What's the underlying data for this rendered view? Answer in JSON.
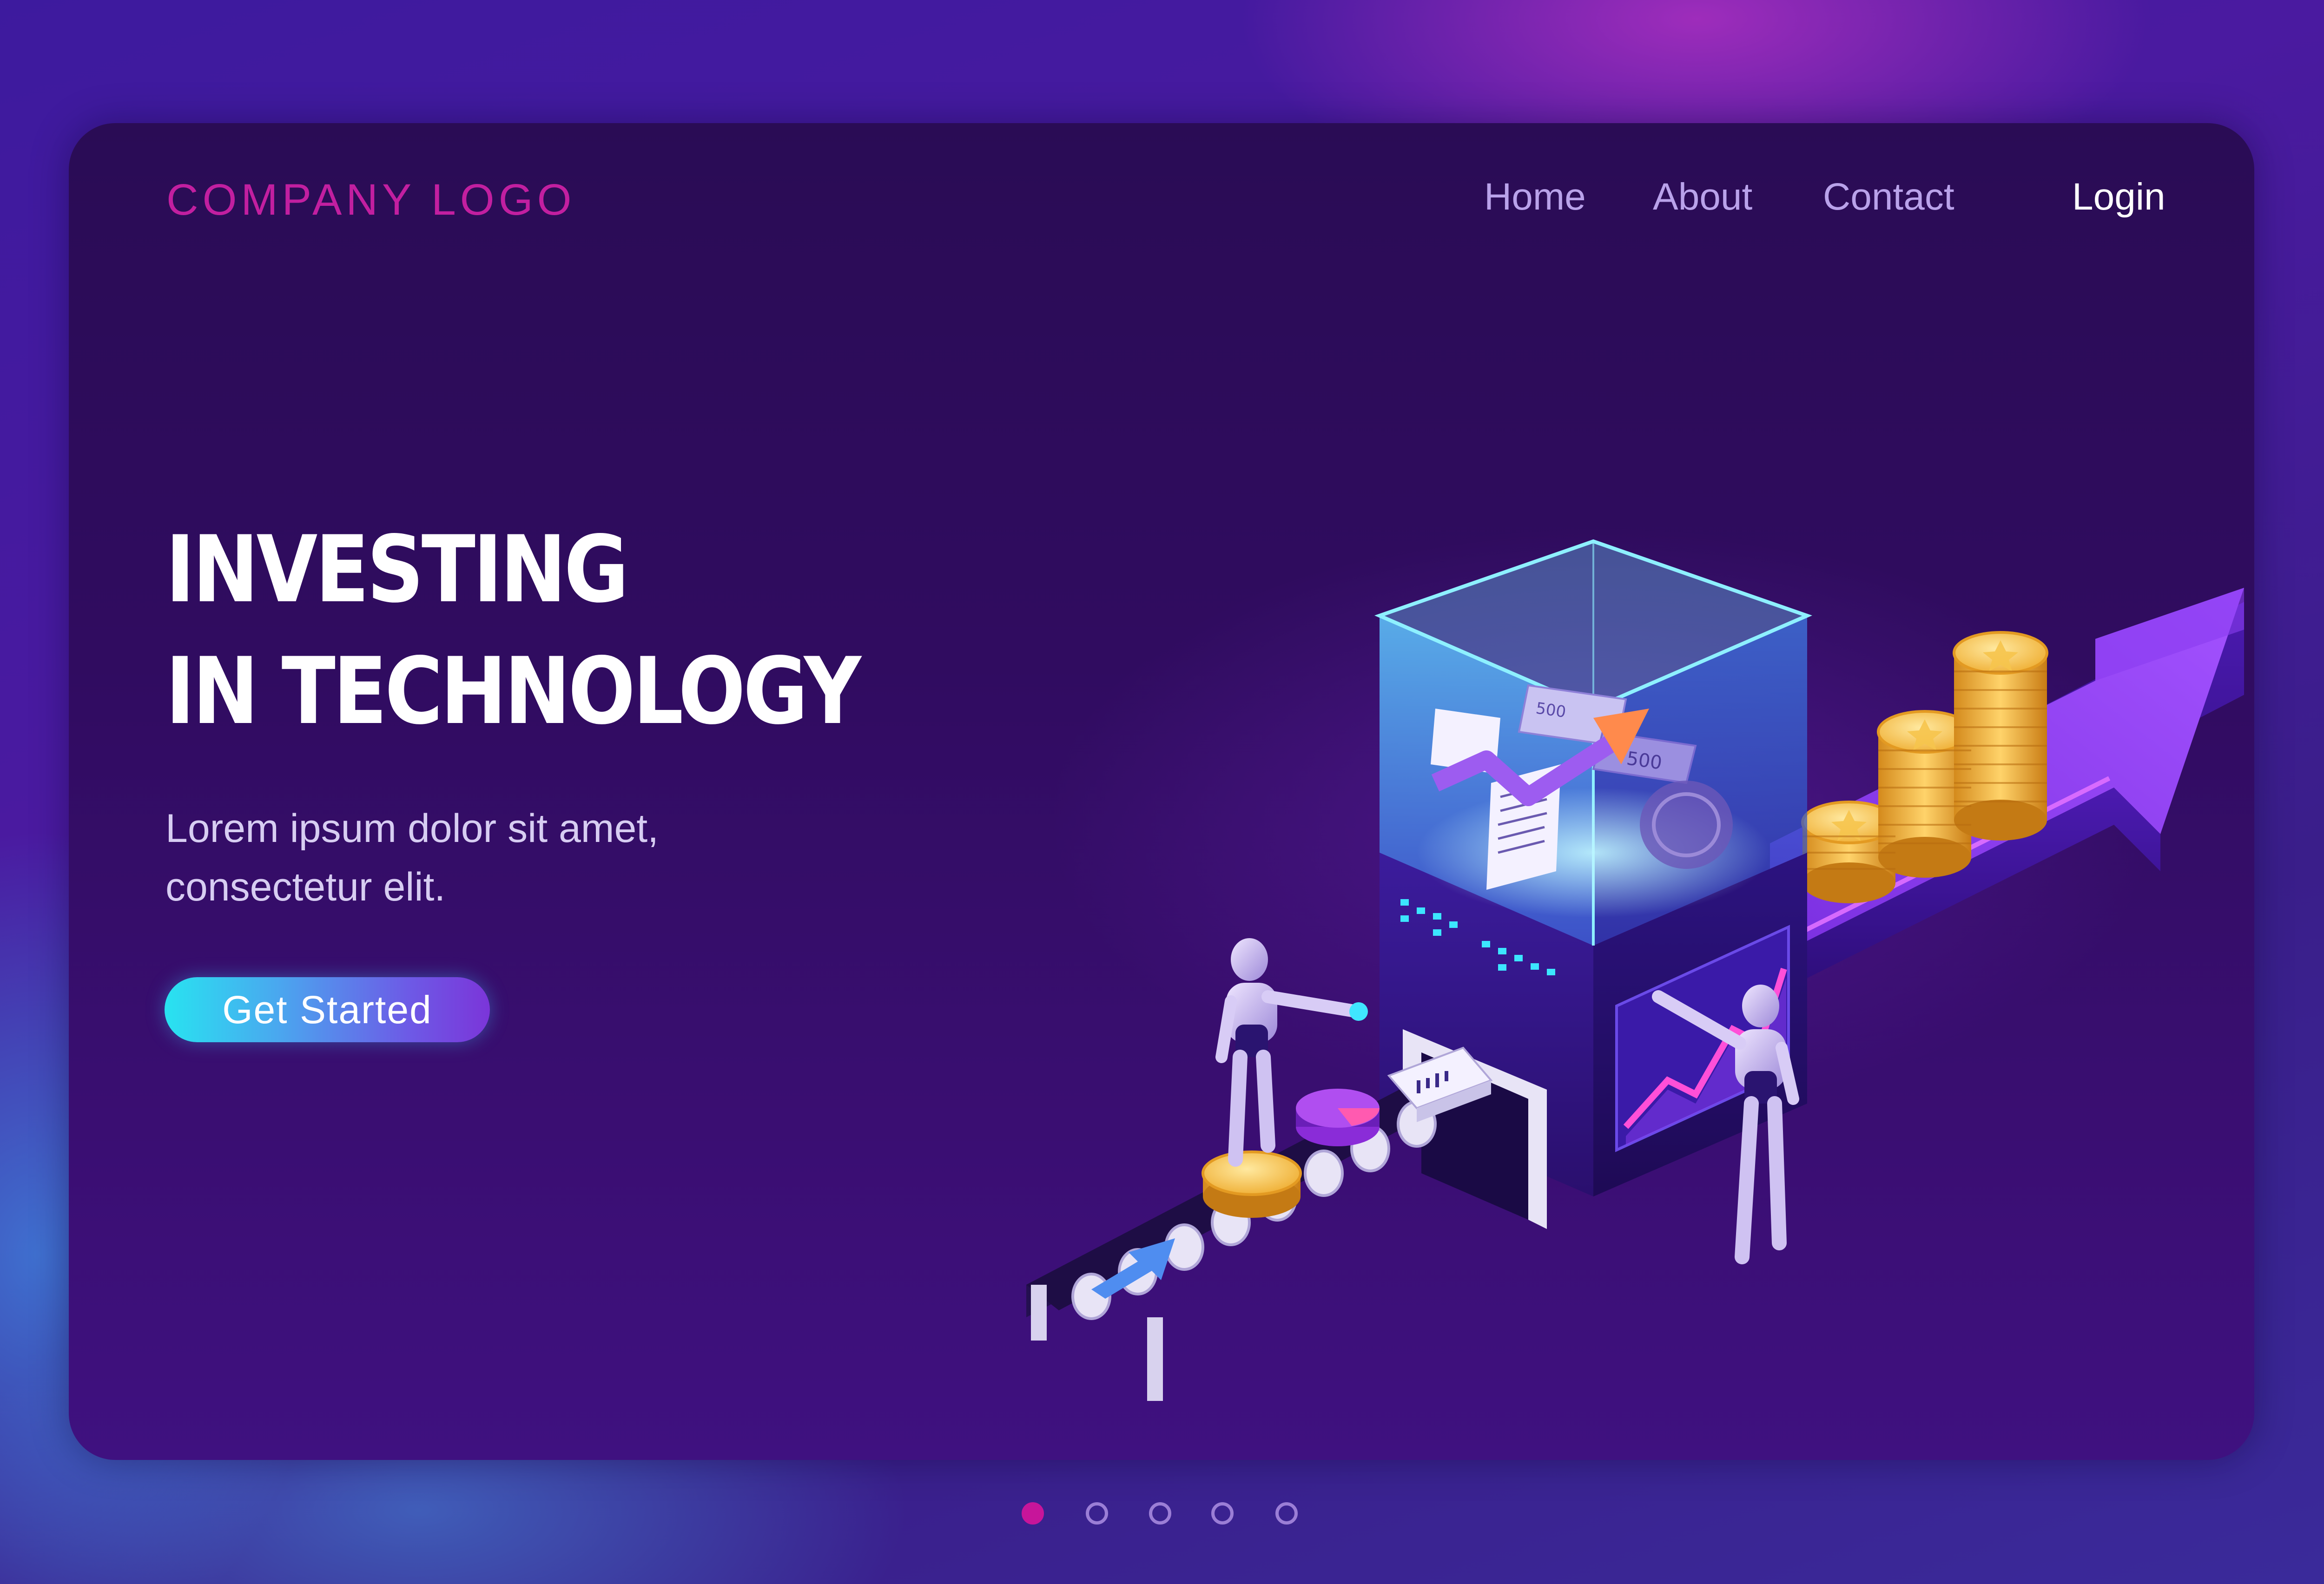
{
  "brand": {
    "logo_text": "COMPANY LOGO",
    "logo_color": "#c21fa0"
  },
  "nav": {
    "items": [
      {
        "label": "Home"
      },
      {
        "label": "About"
      },
      {
        "label": "Contact"
      }
    ],
    "login_label": "Login"
  },
  "hero": {
    "title_lines": [
      "INVESTING",
      "IN TECHNOLOGY"
    ],
    "subtitle_lines": [
      "Lorem ipsum dolor sit amet,",
      "consectetur elit."
    ],
    "cta_label": "Get Started"
  },
  "illustration": {
    "icons": [
      "conveyor-belt",
      "processing-cube",
      "robot",
      "robot",
      "coin-stack",
      "growth-arrow",
      "pie-chart",
      "document",
      "banknote"
    ],
    "banknote_values": [
      "500",
      "500"
    ]
  },
  "pagination": {
    "count": 5,
    "active_index": 0,
    "active_color": "#c7159a"
  },
  "colors": {
    "accent_gradient_start": "#28e3f0",
    "accent_gradient_end": "#7b35d9",
    "background": "#2a0c55"
  }
}
